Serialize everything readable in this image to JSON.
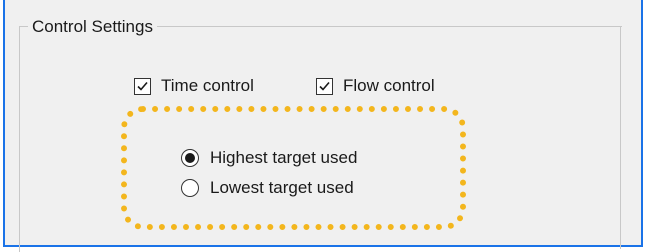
{
  "group": {
    "title": "Control Settings"
  },
  "checkboxes": [
    {
      "label": "Time control",
      "checked": true
    },
    {
      "label": "Flow control",
      "checked": true
    }
  ],
  "radios": [
    {
      "label": "Highest target used",
      "selected": true
    },
    {
      "label": "Lowest target used",
      "selected": false
    }
  ],
  "colors": {
    "highlight": "#f3b61d",
    "window_border": "#1a73e8"
  }
}
